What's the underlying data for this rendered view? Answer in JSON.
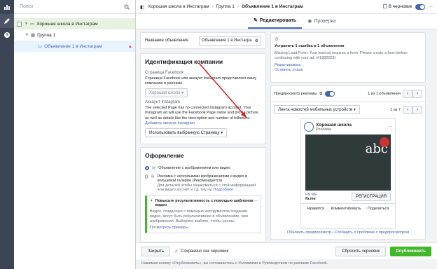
{
  "tree": {
    "search_placeholder": "Поиск",
    "campaign": "Хорошая школа в Инстаграм",
    "adset": "Группа 1",
    "ad": "Объявление 1 в Инстаграм"
  },
  "topbar": {
    "c1": "Хорошая школа в Инстаграм",
    "c2": "Группа 1",
    "c3": "Объявление 1 в Инстаграм",
    "draft": "В черновик"
  },
  "tabs": {
    "edit": "Редактировать",
    "review": "Проверка"
  },
  "name_card": {
    "label": "Название объявления",
    "value": "Объявление 1 в Инстагра"
  },
  "identity": {
    "title": "Идентификация компании",
    "fb_label": "Страница Facebook",
    "fb_desc": "Страница Facebook или аккаунт Instagram представляет вашу компанию в рекламе.",
    "page_name": "Хорошая школа",
    "ig_label": "Аккаунт Instagram",
    "ig_desc": "The selected Page has no connected Instagram account. Your Instagram ad will use the Facebook Page name and profile picture, as well as details like the description and number of followers.",
    "ig_link": "Добавить аккаунт Instagram",
    "use_page": "Использовать выбранную Страницу"
  },
  "format": {
    "title": "Оформление",
    "opt1": "Объявление с изображением или видео",
    "opt2": "Реклама с несколькими изображениями и видео в кольцевой галерее (Рекомендуется)",
    "opt2_desc": "Для деталей чтобы ознакомиться с этой информацией или видео за счёт и т.д. тиу ну.",
    "opt2_link": "Подробнее",
    "tip_title": "Повысьте результативность с помощью шаблонов видео",
    "tip_desc": "Видео, созданные с помощью инструментов создания видео, могут быть результативнее в объявлениях, чем изображения. Выберите шаблон, чтобы начать.",
    "tip_link": "Посмотреть примеры"
  },
  "error": {
    "title": "Устранить 1 ошибка в 1 объявлении",
    "text": "Missing Lead Form: Your lead ad requires a form. Please create a form before continuing with your ad. (#1892023)",
    "edit": "Редактировать",
    "leave": "Оставить отзыв"
  },
  "preview": {
    "title": "Предпросмотр рекламы",
    "count": "1 из 1 объявления",
    "placement": "Лента новостей мобильных устройств",
    "pages": "1 из 7",
    "page_name": "Хорошая школа",
    "sponsored": "Реклама",
    "domain_small": "FB.ME",
    "domain": "fb.me",
    "cta": "РЕГИСТРАЦИЯ",
    "like": "Нравится",
    "comment": "Комментировать",
    "share": "Поделиться",
    "footer": "Обновить предпросмотр • Сообщить о проблеме с предпросмотром"
  },
  "bottom": {
    "close": "Закрыть",
    "saved": "Сохранено как черновик",
    "reset": "Сбросить черновик",
    "publish": "Опубликовать",
    "note": "Нажимая кнопку «Опубликовать», вы соглашаетесь с Условиями и Руководством по рекламе Facebook."
  }
}
